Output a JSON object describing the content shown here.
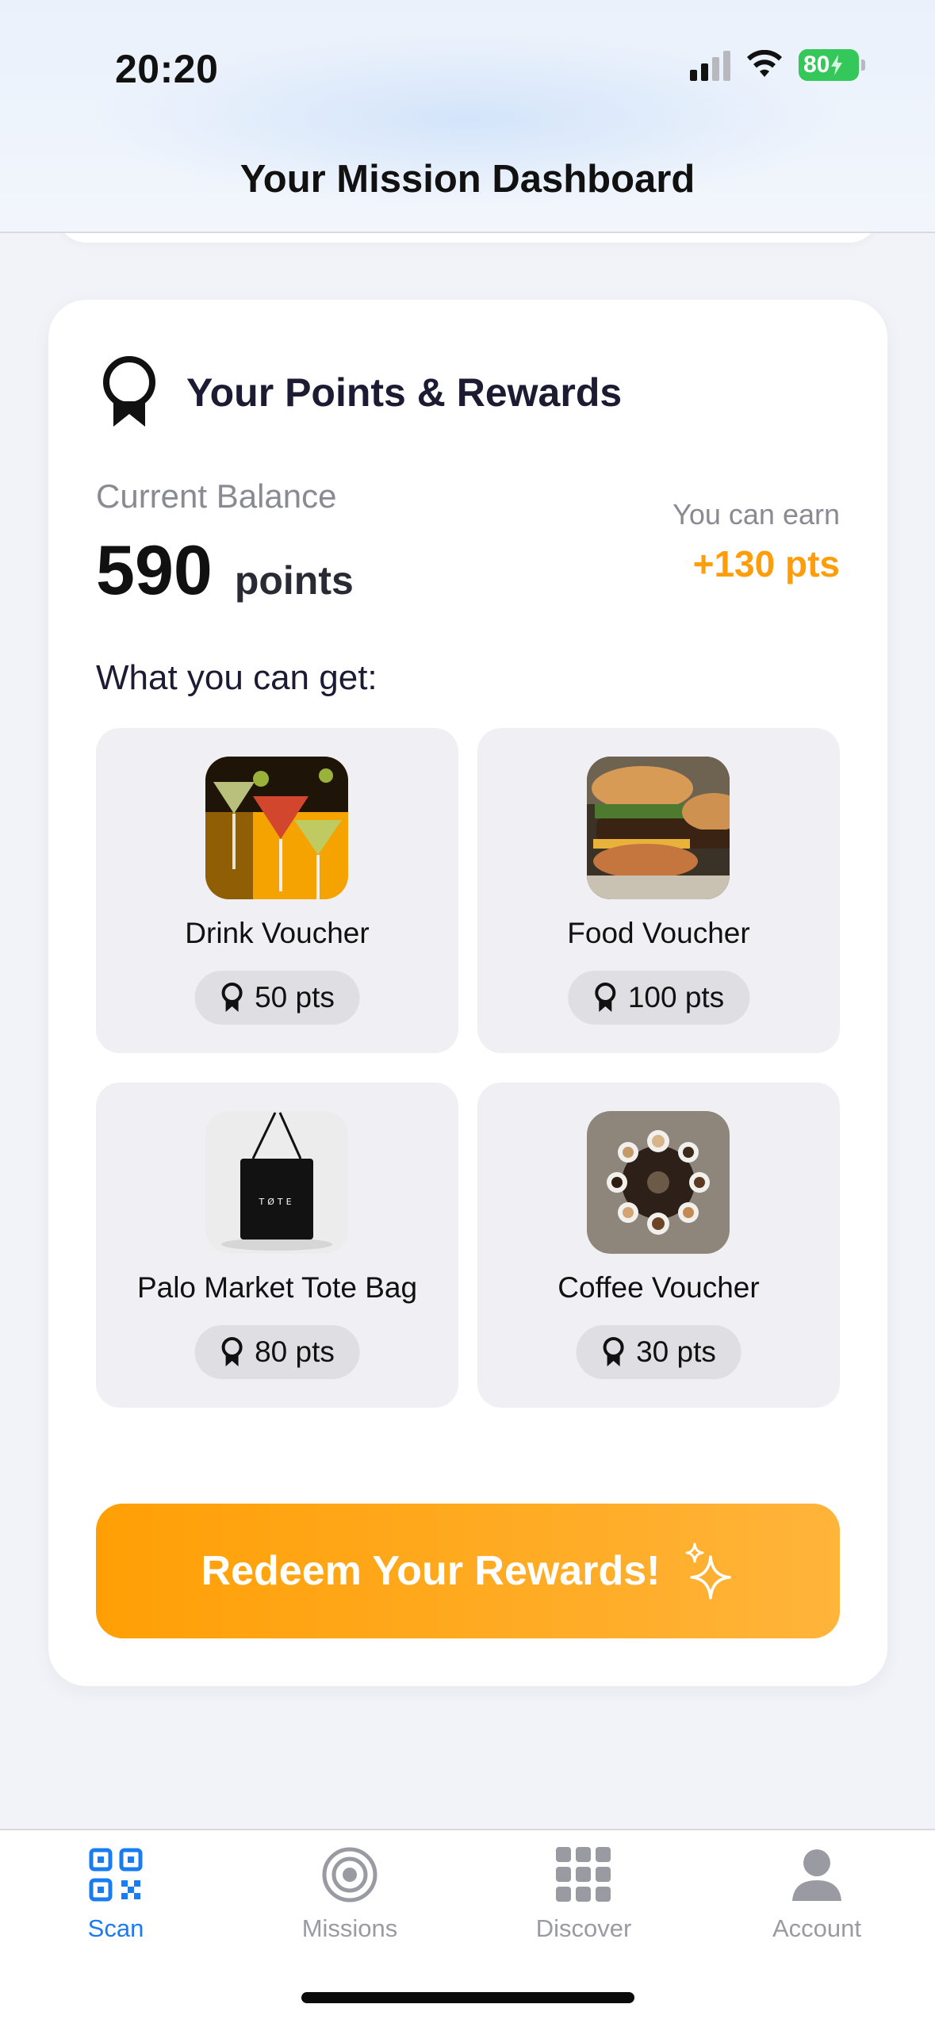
{
  "status": {
    "time": "20:20",
    "battery": "80"
  },
  "header": {
    "title": "Your Mission Dashboard"
  },
  "rewards": {
    "title": "Your Points & Rewards",
    "balance_label": "Current Balance",
    "balance_value": "590",
    "balance_unit": "points",
    "earn_label": "You can earn",
    "earn_value": "+130 pts",
    "get_label": "What you can get:",
    "items": [
      {
        "name": "Drink Voucher",
        "points": "50 pts"
      },
      {
        "name": "Food Voucher",
        "points": "100 pts"
      },
      {
        "name": "Palo Market Tote Bag",
        "points": "80 pts"
      },
      {
        "name": "Coffee Voucher",
        "points": "30 pts"
      }
    ],
    "redeem_label": "Redeem Your Rewards!"
  },
  "tabs": [
    {
      "label": "Scan",
      "icon": "qr-code-icon",
      "active": true
    },
    {
      "label": "Missions",
      "icon": "target-icon",
      "active": false
    },
    {
      "label": "Discover",
      "icon": "grid-icon",
      "active": false
    },
    {
      "label": "Account",
      "icon": "person-icon",
      "active": false
    }
  ],
  "colors": {
    "accent": "#ff9d0a",
    "tab_active": "#1a7cf2",
    "tab_inactive": "#9a9aa2"
  }
}
